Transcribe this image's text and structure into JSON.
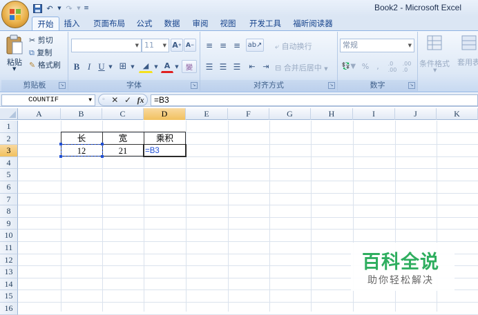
{
  "window": {
    "title": "Book2 - Microsoft Excel"
  },
  "tabs": [
    "开始",
    "插入",
    "页面布局",
    "公式",
    "数据",
    "审阅",
    "视图",
    "开发工具",
    "福昕阅读器"
  ],
  "active_tab": "开始",
  "ribbon": {
    "clipboard": {
      "paste": "粘贴",
      "cut": "剪切",
      "copy": "复制",
      "format_painter": "格式刷",
      "label": "剪贴板"
    },
    "font": {
      "font_name": "",
      "font_size": "11",
      "label": "字体"
    },
    "alignment": {
      "wrap_text": "自动换行",
      "merge_center": "合并后居中",
      "label": "对齐方式"
    },
    "number": {
      "format": "常规",
      "label": "数字"
    },
    "styles": {
      "conditional_format": "条件格式",
      "table_format": "套用表格格式"
    }
  },
  "formula_bar": {
    "name_box": "COUNTIF",
    "formula": "=B3",
    "fx": "fx"
  },
  "columns": [
    "A",
    "B",
    "C",
    "D",
    "E",
    "F",
    "G",
    "H",
    "I",
    "J",
    "K"
  ],
  "rows": [
    "1",
    "2",
    "3",
    "4",
    "5",
    "6",
    "7",
    "8",
    "9",
    "10",
    "11",
    "12",
    "13",
    "14",
    "15",
    "16"
  ],
  "selected_column": "D",
  "selected_row": "3",
  "cells": {
    "B2": "长",
    "C2": "宽",
    "D2": "乘积",
    "B3": "12",
    "C3": "21",
    "D3": "=B3"
  },
  "colors": {
    "accent": "#15428b",
    "ref_blue": "#1f4fd6",
    "watermark": "#2fae5f"
  },
  "watermark": {
    "title": "百科全说",
    "subtitle": "助你轻松解决"
  }
}
